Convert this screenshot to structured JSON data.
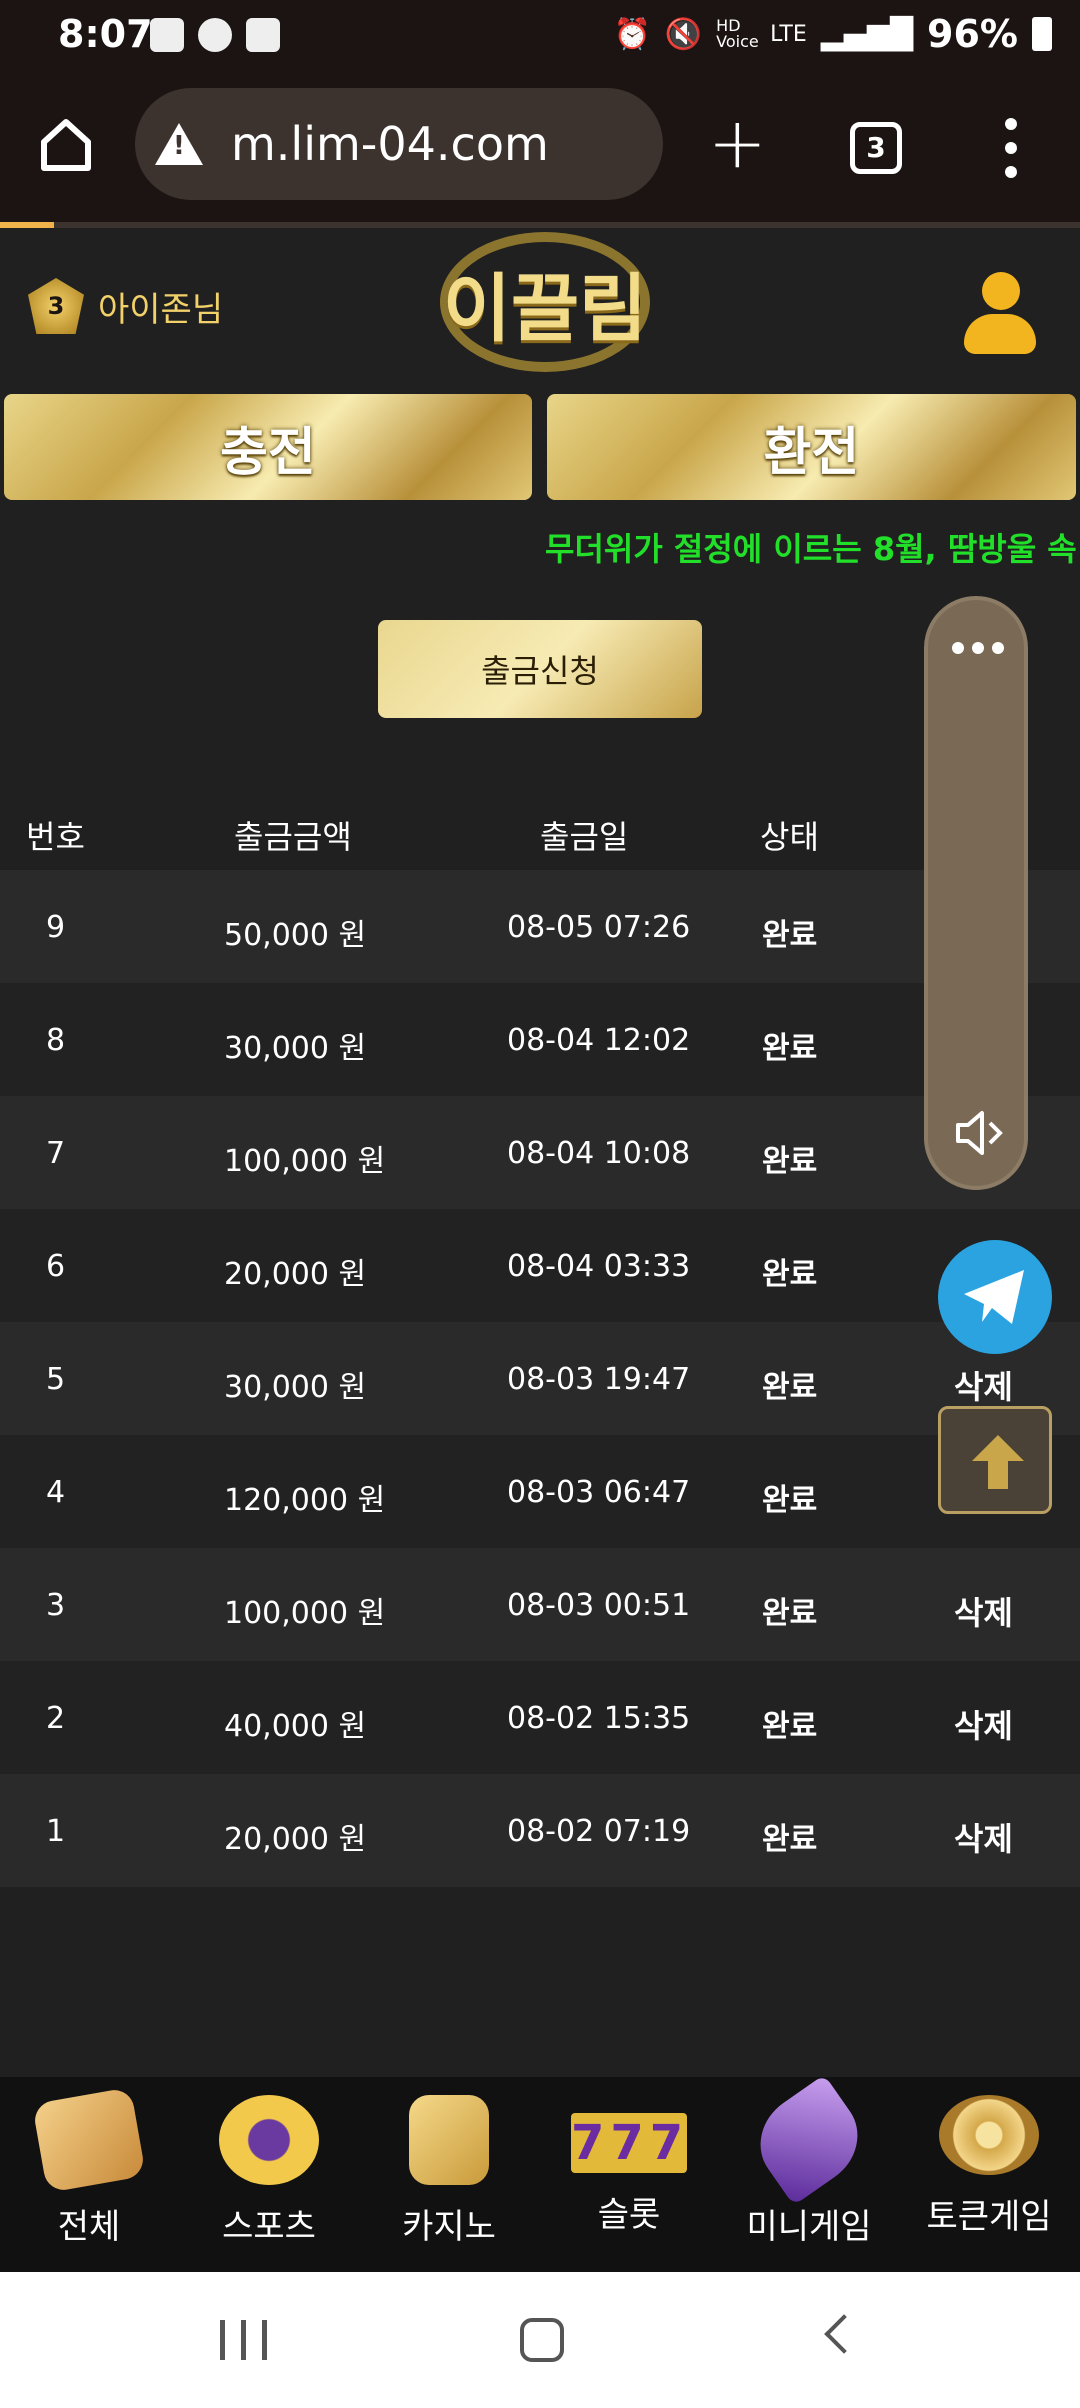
{
  "status_bar": {
    "time": "8:07",
    "battery": "96%",
    "network": "LTE",
    "hd_voice": "HD Voice"
  },
  "browser": {
    "url": "m.lim-04.com",
    "tab_count": "3",
    "page_load_progress": 0.05
  },
  "site": {
    "user_label": "아이존님",
    "level_badge": "3",
    "logo_text": "이끌림",
    "charge_button": "충전",
    "exchange_button": "환전",
    "marquee_text": "무더위가 절정에 이르는 8월, 땀방울 속",
    "withdraw_request_button": "출금신청"
  },
  "table": {
    "headers": {
      "num": "번호",
      "amount": "출금금액",
      "date": "출금일",
      "status": "상태"
    },
    "rows": [
      {
        "num": "9",
        "amount": "50,000 원",
        "date": "08-05 07:26",
        "status": "완료",
        "action": ""
      },
      {
        "num": "8",
        "amount": "30,000 원",
        "date": "08-04 12:02",
        "status": "완료",
        "action": ""
      },
      {
        "num": "7",
        "amount": "100,000 원",
        "date": "08-04 10:08",
        "status": "완료",
        "action": ""
      },
      {
        "num": "6",
        "amount": "20,000 원",
        "date": "08-04 03:33",
        "status": "완료",
        "action": ""
      },
      {
        "num": "5",
        "amount": "30,000 원",
        "date": "08-03 19:47",
        "status": "완료",
        "action": "삭제"
      },
      {
        "num": "4",
        "amount": "120,000 원",
        "date": "08-03 06:47",
        "status": "완료",
        "action": ""
      },
      {
        "num": "3",
        "amount": "100,000 원",
        "date": "08-03 00:51",
        "status": "완료",
        "action": "삭제"
      },
      {
        "num": "2",
        "amount": "40,000 원",
        "date": "08-02 15:35",
        "status": "완료",
        "action": "삭제"
      },
      {
        "num": "1",
        "amount": "20,000 원",
        "date": "08-02 07:19",
        "status": "완료",
        "action": "삭제"
      }
    ]
  },
  "bottom_nav": [
    {
      "label": "전체",
      "icon": "dice-icon"
    },
    {
      "label": "스포츠",
      "icon": "soccer-ball-icon"
    },
    {
      "label": "카지노",
      "icon": "cards-icon"
    },
    {
      "label": "슬롯",
      "icon": "slot-777-icon"
    },
    {
      "label": "미니게임",
      "icon": "rocket-icon"
    },
    {
      "label": "토큰게임",
      "icon": "roulette-icon"
    }
  ],
  "colors": {
    "accent_gold": "#d9bf6a",
    "marquee_green": "#22e02a",
    "telegram_blue": "#2aa3e0"
  }
}
